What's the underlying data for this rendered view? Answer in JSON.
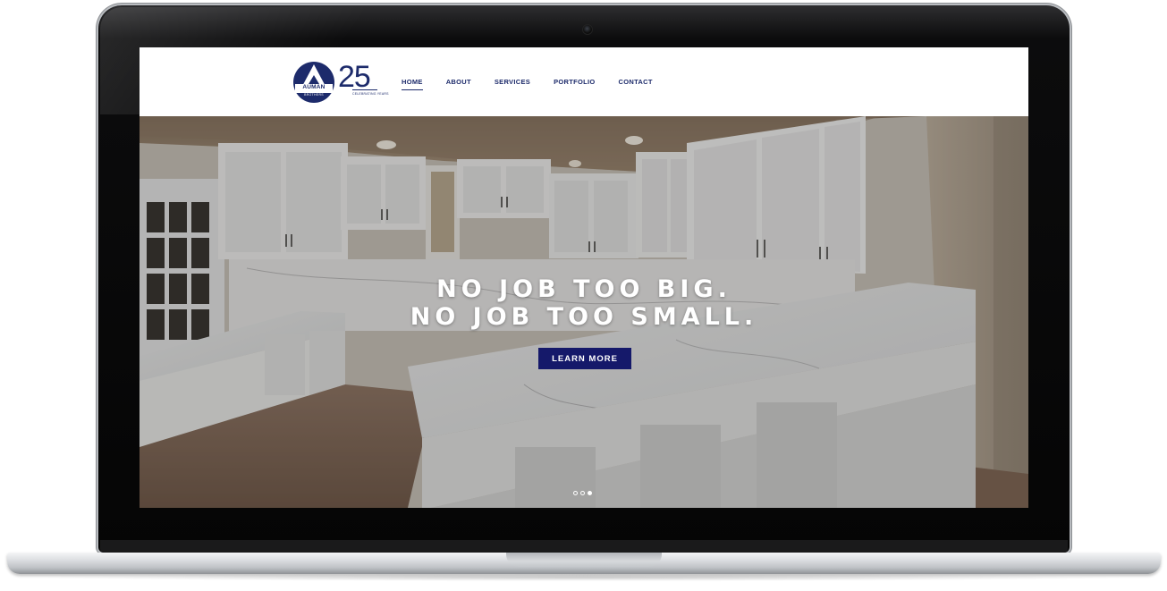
{
  "logo": {
    "brand": "AUMAN",
    "subtitle": "BROTHERS",
    "anniversary": "25",
    "anniversary_caption": "CELEBRATING YEARS"
  },
  "nav": {
    "items": [
      {
        "label": "HOME",
        "active": true
      },
      {
        "label": "ABOUT",
        "active": false
      },
      {
        "label": "SERVICES",
        "active": false
      },
      {
        "label": "PORTFOLIO",
        "active": false
      },
      {
        "label": "CONTACT",
        "active": false
      }
    ]
  },
  "hero": {
    "headline_line1": "NO JOB TOO BIG.",
    "headline_line2": "NO JOB TOO SMALL.",
    "cta_label": "LEARN MORE",
    "image": "kitchen-photo",
    "slides": 3,
    "active_slide": 3
  },
  "colors": {
    "brand_navy": "#1d2b6b",
    "cta": "#15196a",
    "nav_text": "#1d2b6b"
  }
}
